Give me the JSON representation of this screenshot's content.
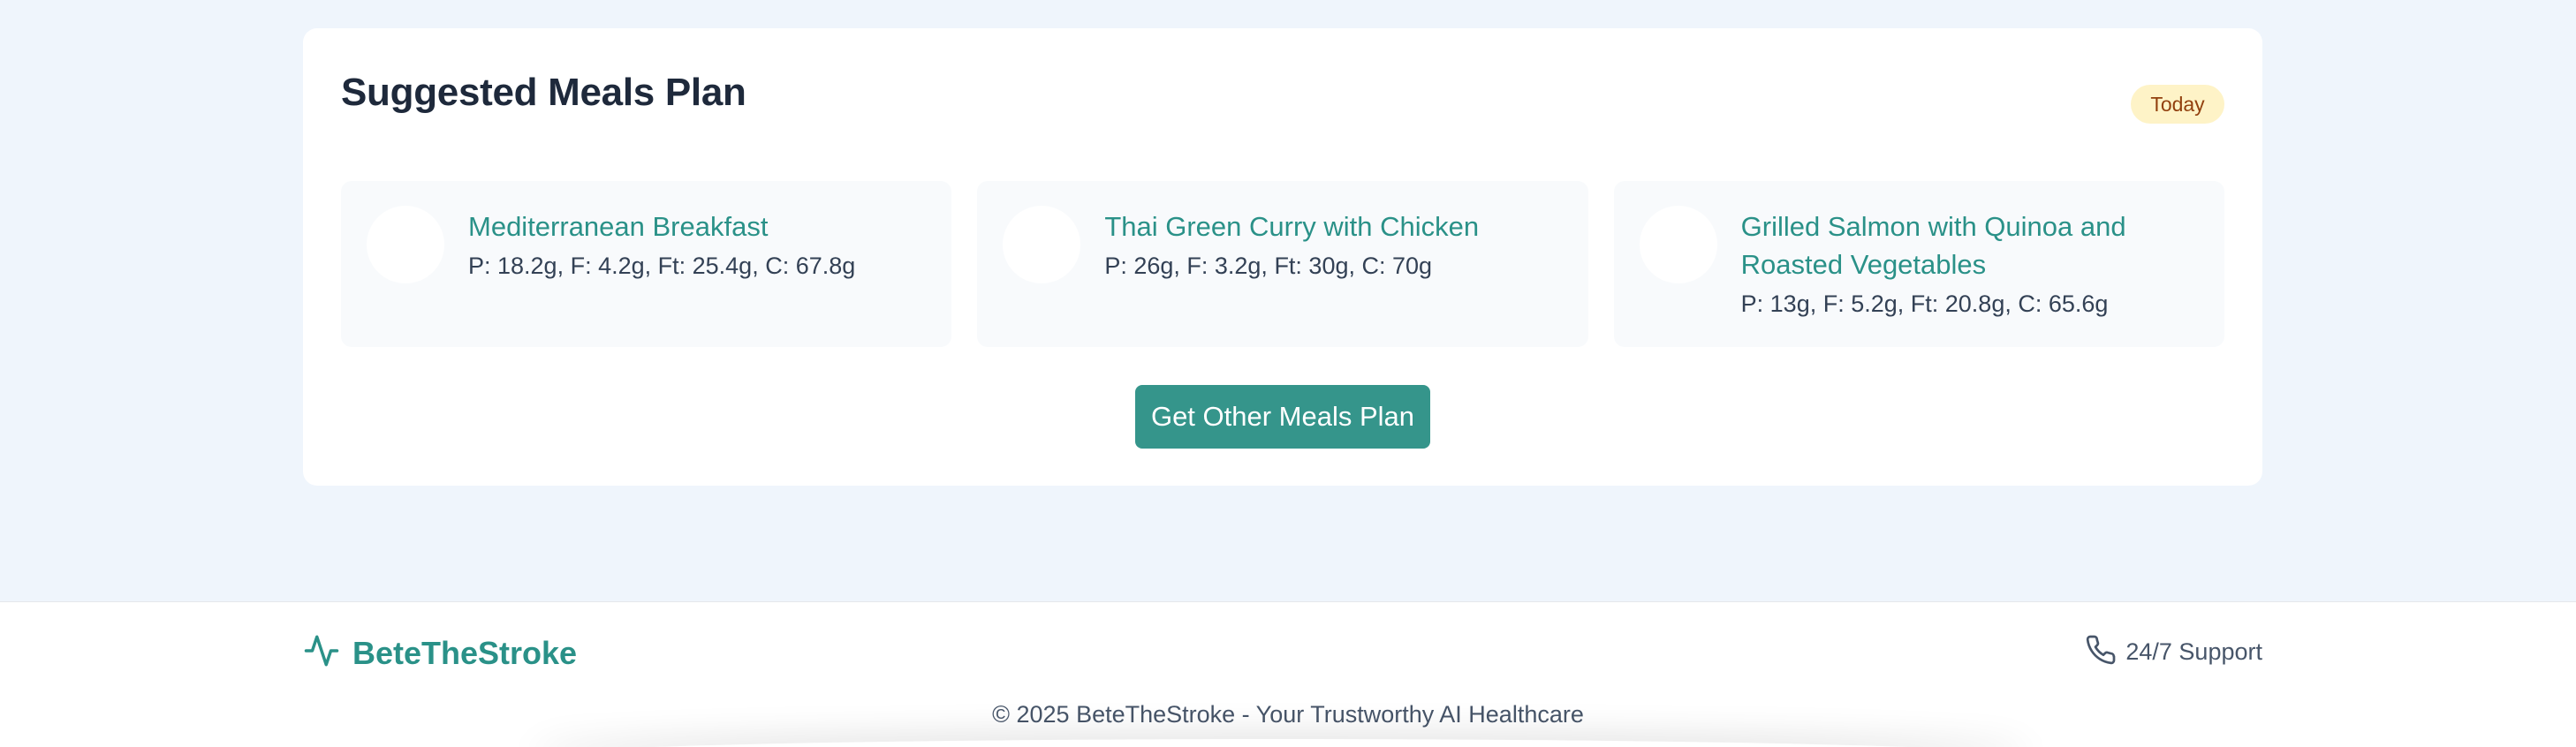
{
  "meals_card": {
    "title": "Suggested Meals Plan",
    "badge": "Today",
    "meals": [
      {
        "name": "Mediterranean Breakfast",
        "macros": "P: 18.2g, F: 4.2g, Ft: 25.4g, C: 67.8g"
      },
      {
        "name": "Thai Green Curry with Chicken",
        "macros": "P: 26g, F: 3.2g, Ft: 30g, C: 70g"
      },
      {
        "name": "Grilled Salmon with Quinoa and Roasted Vegetables",
        "macros": "P: 13g, F: 5.2g, Ft: 20.8g, C: 65.6g"
      }
    ],
    "cta_label": "Get Other Meals Plan"
  },
  "footer": {
    "brand_name": "BeteTheStroke",
    "brand_icon": "activity-icon",
    "support_icon": "phone-icon",
    "support_label": "24/7 Support",
    "copyright": "© 2025 BeteTheStroke - Your Trustworthy AI Healthcare"
  },
  "colors": {
    "accent": "#2a9188",
    "button": "#35958b",
    "badge_bg": "#fef3c7",
    "badge_text": "#92400e",
    "page_bg": "#eff5fc"
  }
}
